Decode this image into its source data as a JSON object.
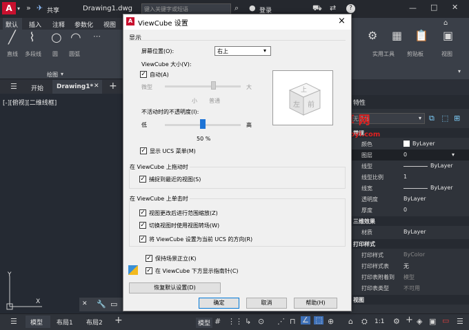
{
  "title_bar": {
    "app_logo": "A",
    "share": "共享",
    "filename": "Drawing1.dwg",
    "search_placeholder": "键入关键字或短语",
    "login": "登录",
    "help": "?"
  },
  "ribbon": {
    "tabs": [
      "默认",
      "插入",
      "注释",
      "参数化",
      "视图"
    ],
    "tools": [
      "直线",
      "多段线",
      "圆",
      "圆弧"
    ],
    "panel_label": "绘图",
    "right_tools": [
      "实用工具",
      "剪贴板",
      "视图"
    ]
  },
  "doc_tabs": {
    "start": "开始",
    "active": "Drawing1*"
  },
  "viewport_label": "[-][俯视][二维线框]",
  "ucs": {
    "x": "X",
    "y": "Y"
  },
  "status_tabs": [
    "模型",
    "布局1",
    "布局2"
  ],
  "status_right": {
    "model": "模型",
    "scale": "1:1"
  },
  "properties": {
    "title": "特性",
    "selection": "无选择",
    "sections": {
      "general": {
        "title": "常规",
        "rows": [
          [
            "颜色",
            "ByLayer"
          ],
          [
            "图层",
            "0"
          ],
          [
            "线型",
            "ByLayer"
          ],
          [
            "线型比例",
            "1"
          ],
          [
            "线宽",
            "ByLayer"
          ],
          [
            "透明度",
            "ByLayer"
          ],
          [
            "厚度",
            "0"
          ]
        ]
      },
      "three_d": {
        "title": "三维效果",
        "rows": [
          [
            "材质",
            "ByLayer"
          ]
        ]
      },
      "plot": {
        "title": "打印样式",
        "rows": [
          [
            "打印样式",
            "ByColor"
          ],
          [
            "打印样式表",
            "无"
          ],
          [
            "打印表附着到",
            "模型"
          ],
          [
            "打印表类型",
            "不可用"
          ]
        ]
      },
      "view": {
        "title": "视图"
      }
    }
  },
  "watermark": {
    "line1": "我 爱 分 享 网",
    "line2": "www.zhanshaoyi.com"
  },
  "dialog": {
    "title": "ViewCube 设置",
    "close": "×",
    "display_group": "显示",
    "screen_pos_label": "屏幕位置(O):",
    "screen_pos_value": "右上",
    "size_label": "ViewCube 大小(V):",
    "auto_label": "自动(A)",
    "size_small": "微型",
    "size_tiny": "小",
    "size_normal": "普通",
    "size_large": "大",
    "opacity_label": "不活动时的不透明度(I):",
    "opacity_low": "低",
    "opacity_high": "高",
    "opacity_value": "50 %",
    "opacity_fraction": 0.5,
    "show_ucs_label": "显示 UCS 菜单(M)",
    "drag_group": "在 ViewCube 上拖动时",
    "snap_label": "捕捉到最近的视图(S)",
    "click_group": "在 ViewCube 上单击时",
    "fit_label": "视图更改后进行范围缩放(Z)",
    "transition_label": "切换视图时使用视图转场(W)",
    "ucs_orient_label": "将 ViewCube 设置为当前 UCS 的方向(R)",
    "upright_label": "保持场景正立(K)",
    "compass_label": "在 ViewCube 下方显示指南针(C)",
    "restore_label": "恢复默认设置(D)",
    "ok": "确定",
    "cancel": "取消",
    "help": "帮助(H)",
    "cube_faces": {
      "top": "上",
      "front": "前",
      "left": "左"
    }
  }
}
